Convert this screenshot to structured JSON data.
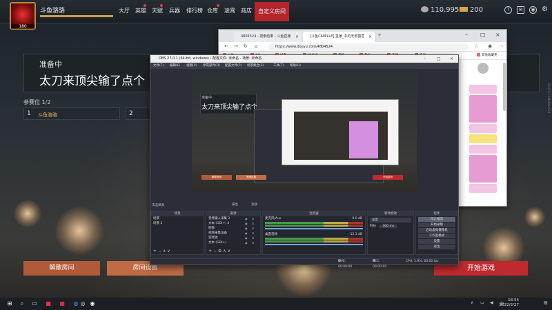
{
  "game": {
    "player_name": "斗鱼骆骆",
    "avatar_level": "180",
    "xp_percent": 100,
    "nav": [
      "大厅",
      "英雄",
      "天赋",
      "兵器",
      "排行榜",
      "仓库",
      "凌霄",
      "商店",
      "自定义房间"
    ],
    "active_nav": "自定义房间",
    "currency_silver": "110,995",
    "currency_gold": "200",
    "room_status": "准备中",
    "room_title": "太刀来顶尖输了点个",
    "seats_label": "参赛位 1/2",
    "seat1_number": "1",
    "seat1_name": "斗鱼骆骆",
    "seat2_number": "2",
    "btn_disband": "解散房间",
    "btn_room_settings": "房间设置",
    "btn_start": "开始游戏",
    "top_icons": [
      "question-icon",
      "mail-icon",
      "settings-icon"
    ]
  },
  "browser": {
    "tabs": [
      {
        "label": "4804524 - 搜索结果 - 斗鱼直播"
      },
      {
        "label": "[斗鱼CAMILLE] 直播_中的无邪露营"
      }
    ],
    "address": "https://www.douyu.com/4804524",
    "bookmarks": [
      "斗鱼",
      "1个",
      "好看",
      "MUSIC",
      "无敌",
      "我们",
      "选项",
      "资讯",
      "其他收藏夹"
    ],
    "accent": "#e89ad3"
  },
  "obs": {
    "title": "OBS 27.0.1 (64-bit, windows) - 配置文件: 未命名 - 场景: 未命名",
    "menu": [
      "文件(F)",
      "编辑(E)",
      "视图(V)",
      "停靠部件(D)",
      "配置文件(P)",
      "场景集合(S)",
      "工具(T)",
      "帮助(H)"
    ],
    "no_scene_label": "未选择源",
    "tools": [
      "属性",
      "滤镜"
    ],
    "docks": {
      "scenes": {
        "title": "场景",
        "items": [
          "场景",
          "场景 2"
        ]
      },
      "sources": {
        "title": "来源",
        "items": [
          "音频输入采集 2",
          "文本 (GDI+) 4",
          "图像",
          "视频采集设备",
          "游戏源",
          "文本 (GDI+)"
        ]
      },
      "mixer": {
        "title": "混音器",
        "tracks": [
          {
            "name": "麦克风/Aux",
            "level": "0.0 dB"
          },
          {
            "name": "桌面音频",
            "level": "-12.3 dB"
          }
        ]
      },
      "transitions": {
        "title": "转场特效",
        "type": "淡出",
        "duration_label": "时长",
        "duration": "300 ms"
      },
      "controls": {
        "title": "控件",
        "buttons": [
          "停止推流",
          "开始录制",
          "启动虚拟摄像机",
          "工作室模式",
          "设置",
          "退出"
        ],
        "active": "停止推流"
      }
    },
    "status": {
      "live": "LIVE: 00:00:00",
      "rec": "REC: 00:00:00",
      "cpu": "CPU: 1.9%, 60.00 fps"
    },
    "nested_start": "开始游戏",
    "nested_disband": "解散房间",
    "nested_settings": "房间设置"
  },
  "taskbar": {
    "time": "18:54",
    "date": "2022/2/27",
    "tray_lang": "中"
  },
  "watermark": "DOUYU.COM/4804524"
}
